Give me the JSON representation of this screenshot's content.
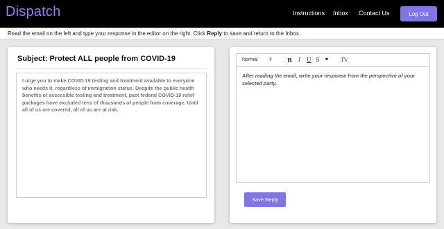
{
  "app": {
    "brand": "Dispatch"
  },
  "nav": {
    "instructions": "Instructions",
    "inbox": "Inbox",
    "contact": "Contact Us",
    "logout": "Log Out"
  },
  "instruction": {
    "before": "Read the email on the left and type your response in the editor on the right. Click ",
    "bold": "Reply",
    "after": " to save and return to the Inbox."
  },
  "email": {
    "subject": "Subject: Protect ALL people from COVID-19",
    "body": "I urge you to make COVID-19 testing and treatment available to everyone who needs it, regardless of immigration status. Despite the public health benefits of accessible testing and treatment, past federal COVID-19 relief packages have excluded tens of thousands of people from coverage. Until all of us are covered, all of us are at risk."
  },
  "editor": {
    "format_select": "Normal",
    "format_arrow": "⇕",
    "bold": "B",
    "italic": "I",
    "underline": "U",
    "strike": "S",
    "quote": "❞",
    "clear": "Tx",
    "placeholder": "After reading the email, write your response from the perspective of your selected party.",
    "save_label": "Save Reply"
  },
  "colors": {
    "accent": "#7f75e4",
    "navbar": "#000000",
    "brand": "#8d83ea"
  }
}
